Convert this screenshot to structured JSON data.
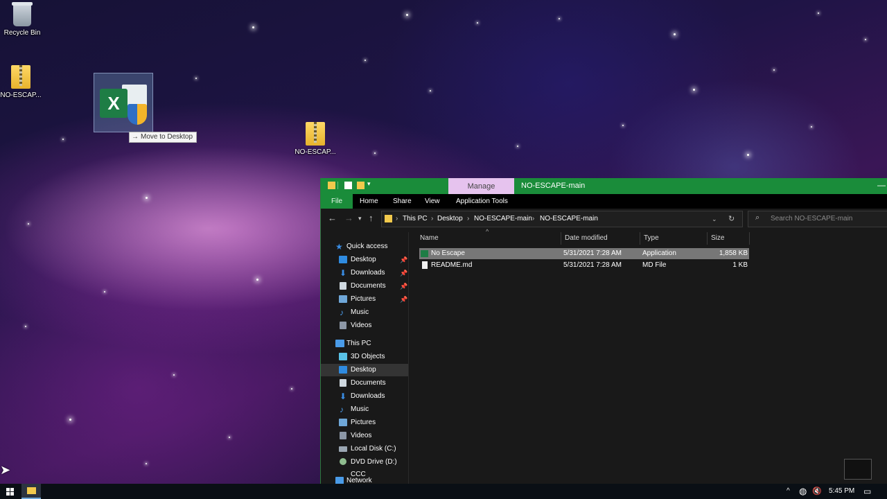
{
  "desktop": {
    "icons": [
      {
        "label": "Recycle Bin",
        "icon": "recycle-bin-icon"
      },
      {
        "label": "NO-ESCAP...",
        "icon": "zip-folder-icon"
      },
      {
        "label": "NO-ESCAP...",
        "icon": "zip-folder-icon"
      }
    ],
    "drag_tooltip": "Move to Desktop",
    "drag_icon": "excel-installer-icon"
  },
  "explorer": {
    "context_tab": "Manage",
    "title": "NO-ESCAPE-main",
    "ribbon_tabs": [
      "File",
      "Home",
      "Share",
      "View",
      "Application Tools"
    ],
    "breadcrumb": [
      "This PC",
      "Desktop",
      "NO-ESCAPE-main",
      "NO-ESCAPE-main"
    ],
    "search_placeholder": "Search NO-ESCAPE-main",
    "nav": {
      "quick_access": {
        "label": "Quick access",
        "items": [
          {
            "label": "Desktop",
            "icon": "desktop-icon",
            "pinned": true
          },
          {
            "label": "Downloads",
            "icon": "downloads-icon",
            "pinned": true
          },
          {
            "label": "Documents",
            "icon": "documents-icon",
            "pinned": true
          },
          {
            "label": "Pictures",
            "icon": "pictures-icon",
            "pinned": true
          },
          {
            "label": "Music",
            "icon": "music-icon",
            "pinned": false
          },
          {
            "label": "Videos",
            "icon": "videos-icon",
            "pinned": false
          }
        ]
      },
      "this_pc": {
        "label": "This PC",
        "items": [
          {
            "label": "3D Objects",
            "icon": "3d-objects-icon"
          },
          {
            "label": "Desktop",
            "icon": "desktop-icon",
            "selected": true
          },
          {
            "label": "Documents",
            "icon": "documents-icon"
          },
          {
            "label": "Downloads",
            "icon": "downloads-icon"
          },
          {
            "label": "Music",
            "icon": "music-icon"
          },
          {
            "label": "Pictures",
            "icon": "pictures-icon"
          },
          {
            "label": "Videos",
            "icon": "videos-icon"
          },
          {
            "label": "Local Disk (C:)",
            "icon": "local-disk-icon"
          },
          {
            "label": "DVD Drive (D:) CCC",
            "icon": "dvd-drive-icon"
          }
        ]
      },
      "network": "Network"
    },
    "columns": [
      "Name",
      "Date modified",
      "Type",
      "Size"
    ],
    "files": [
      {
        "name": "No Escape",
        "date": "5/31/2021 7:28 AM",
        "type": "Application",
        "size": "1,858 KB",
        "selected": true,
        "icon": "application-icon"
      },
      {
        "name": "README.md",
        "date": "5/31/2021 7:28 AM",
        "type": "MD File",
        "size": "1 KB",
        "selected": false,
        "icon": "document-file-icon"
      }
    ]
  },
  "taskbar": {
    "time": "5:45 PM"
  },
  "colors": {
    "titlebar": "#1a8c3a",
    "manage_tab": "#e6c3ee",
    "selection": "#777777",
    "nav_selection": "#343434"
  }
}
